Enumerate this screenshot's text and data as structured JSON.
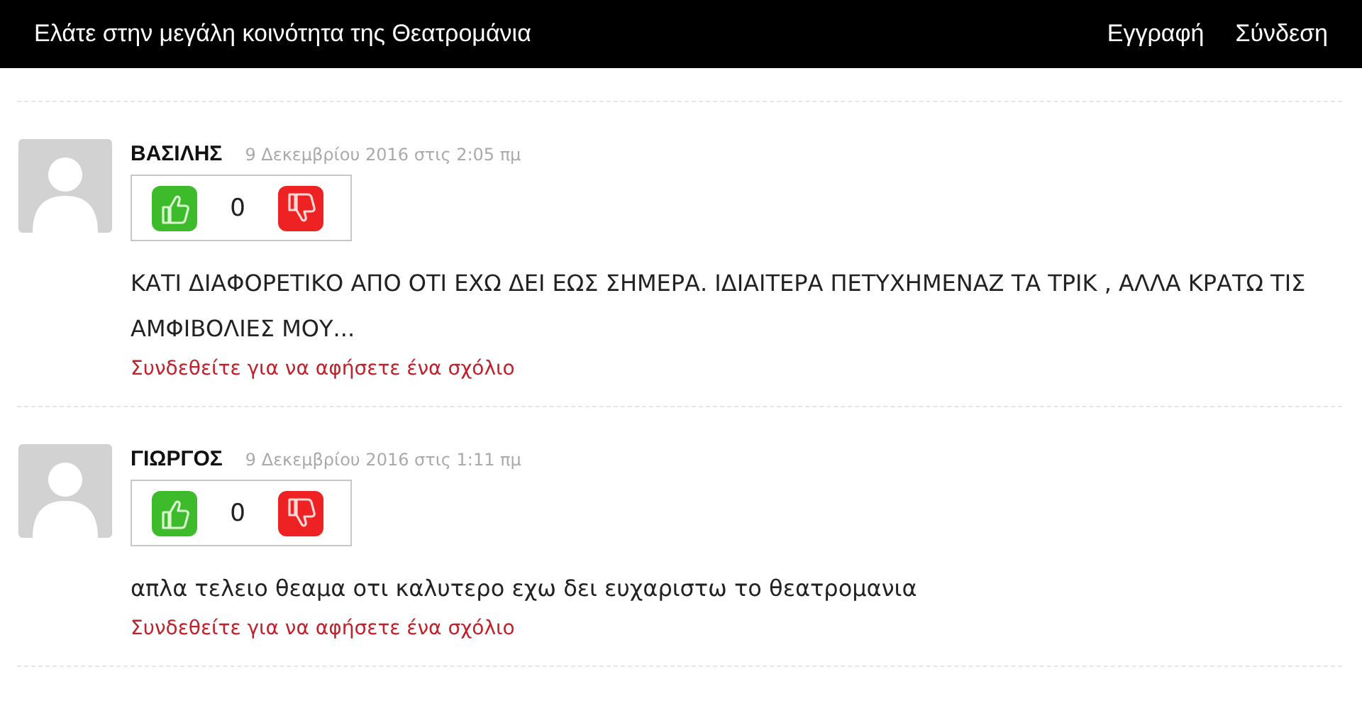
{
  "header": {
    "title": "Ελάτε στην μεγάλη κοινότητα της Θεατρομάνια",
    "links": [
      "Εγγραφή",
      "Σύνδεση"
    ]
  },
  "comments": [
    {
      "author": "ΒΑΣΙΛΗΣ",
      "date": "9 Δεκεμβρίου 2016 στις 2:05 πμ",
      "votes": "0",
      "text": "ΚΑΤΙ ΔΙΑΦΟΡΕΤΙΚΟ ΑΠΟ ΟΤΙ ΕΧΩ ΔΕΙ ΕΩΣ ΣΗΜΕΡΑ. ΙΔΙΑΙΤΕΡΑ ΠΕΤΥΧΗΜΕΝΑΖ ΤΑ ΤΡΙΚ , ΑΛΛΑ ΚΡΑΤΩ ΤΙΣ ΑΜΦΙΒΟΛΙΕΣ ΜΟΥ...",
      "reply_link": "Συνδεθείτε για να αφήσετε ένα σχόλιο"
    },
    {
      "author": "ΓΙΩΡΓΟΣ",
      "date": "9 Δεκεμβρίου 2016 στις 1:11 πμ",
      "votes": "0",
      "text": "απλα τελειο θεαμα οτι καλυτερο εχω δει ευχαριστω το θεατρομανια",
      "reply_link": "Συνδεθείτε για να αφήσετε ένα σχόλιο"
    }
  ]
}
